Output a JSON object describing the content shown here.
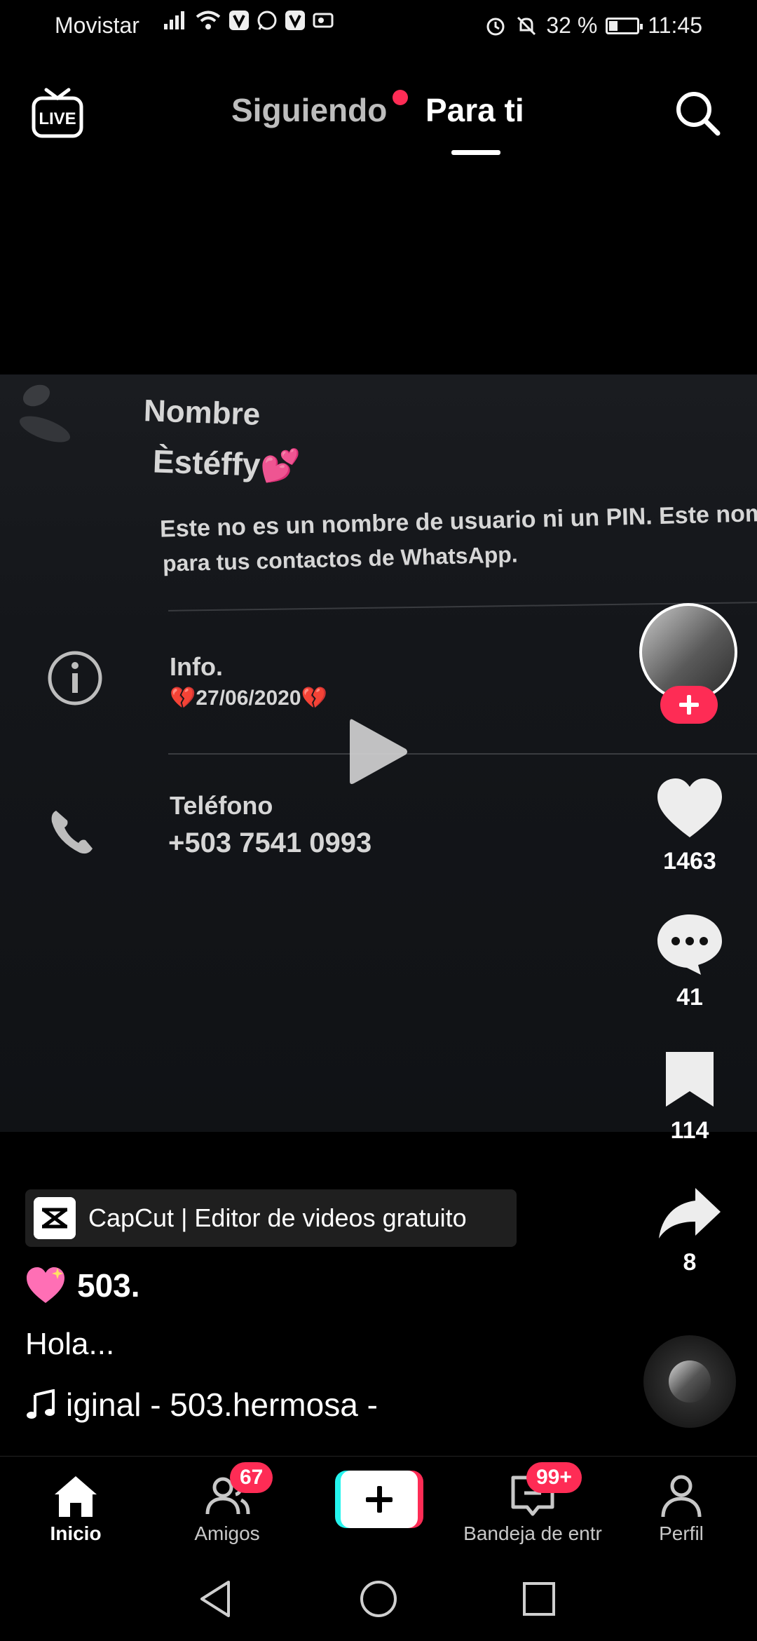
{
  "status_bar": {
    "carrier": "Movistar",
    "battery_percent": "32 %",
    "battery_level": 0.32,
    "time": "11:45"
  },
  "top_nav": {
    "live_label": "LIVE",
    "tabs": [
      {
        "label": "Siguiendo",
        "active": false,
        "has_notification_dot": true
      },
      {
        "label": "Para ti",
        "active": true
      }
    ]
  },
  "video": {
    "contact_card": {
      "name_label": "Nombre",
      "name_value": "Èstéffy💕",
      "name_note_line1": "Este no es un nombre de usuario ni un PIN. Este nomb",
      "name_note_line2": "para tus contactos de WhatsApp.",
      "info_label": "Info.",
      "info_value": "💔27/06/2020💔",
      "phone_label": "Teléfono",
      "phone_value": "+503 7541 0993"
    },
    "state": "paused"
  },
  "actions": {
    "likes": "1463",
    "comments": "41",
    "saves": "114",
    "shares": "8"
  },
  "post": {
    "capcut_label": "CapCut | Editor de videos gratuito",
    "username": "503.",
    "caption": "Hola...",
    "sound": "iginal - 503.hermosa -"
  },
  "bottom_nav": {
    "items": [
      {
        "label": "Inicio",
        "active": true
      },
      {
        "label": "Amigos",
        "badge": "67"
      },
      {
        "label": "Bandeja de entr",
        "badge": "99+"
      },
      {
        "label": "Perfil"
      }
    ]
  },
  "colors": {
    "accent": "#fe2c55",
    "cyan": "#25f4ee",
    "background": "#000000"
  }
}
